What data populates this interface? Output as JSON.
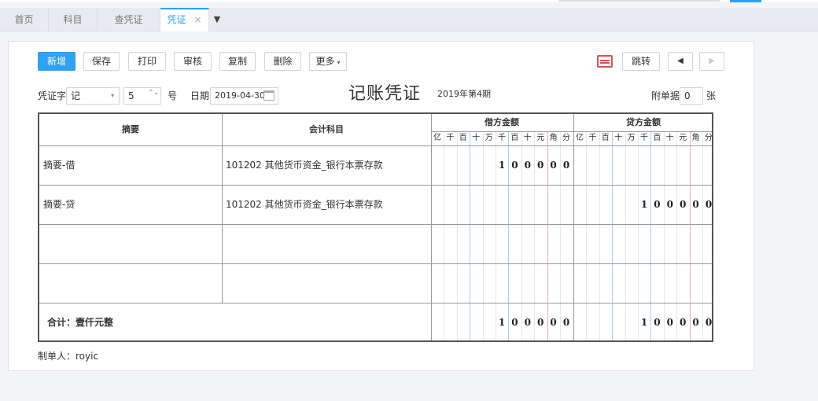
{
  "tabs": [
    {
      "label": "首页"
    },
    {
      "label": "科目"
    },
    {
      "label": "查凭证"
    },
    {
      "label": "凭证",
      "close": "×"
    }
  ],
  "tab_more": "▼",
  "toolbar": {
    "new": "新增",
    "save": "保存",
    "print": "打印",
    "review": "审核",
    "copy": "复制",
    "delete": "删除",
    "more": "更多",
    "more_caret": "▾",
    "jump": "跳转",
    "prev": "◀",
    "next": "▶"
  },
  "form": {
    "voucher_word_label": "凭证字",
    "voucher_word_value": "记",
    "dropdown_caret": "▾",
    "number_value": "5",
    "stepper": "⌃⌄",
    "number_unit": "号",
    "date_label": "日期",
    "date_value": "2019-04-30",
    "title": "记账凭证",
    "period": "2019年第4期",
    "attach_label": "附单据",
    "attach_value": "0",
    "attach_unit": "张"
  },
  "table": {
    "col_summary": "摘要",
    "col_account": "会计科目",
    "col_debit": "借方金额",
    "col_credit": "贷方金额",
    "units": [
      "亿",
      "千",
      "百",
      "十",
      "万",
      "千",
      "百",
      "十",
      "元",
      "角",
      "分"
    ],
    "rows": [
      {
        "summary": "摘要-借",
        "account": "101202 其他货币资金_银行本票存款",
        "debit": [
          "1",
          "0",
          "0",
          "0",
          "0",
          "0"
        ],
        "credit": []
      },
      {
        "summary": "摘要-贷",
        "account": "101202 其他货币资金_银行本票存款",
        "debit": [],
        "credit": [
          "1",
          "0",
          "0",
          "0",
          "0",
          "0"
        ]
      },
      {
        "summary": "",
        "account": "",
        "debit": [],
        "credit": []
      },
      {
        "summary": "",
        "account": "",
        "debit": [],
        "credit": []
      }
    ],
    "total_label": "合计：壹仟元整",
    "total_debit": [
      "1",
      "0",
      "0",
      "0",
      "0",
      "0"
    ],
    "total_credit": [
      "1",
      "0",
      "0",
      "0",
      "0",
      "0"
    ]
  },
  "maker": "制单人：royic",
  "colors": {
    "accent": "#2ea1f2",
    "border": "#555555",
    "kb_icon": "#d9534f"
  }
}
